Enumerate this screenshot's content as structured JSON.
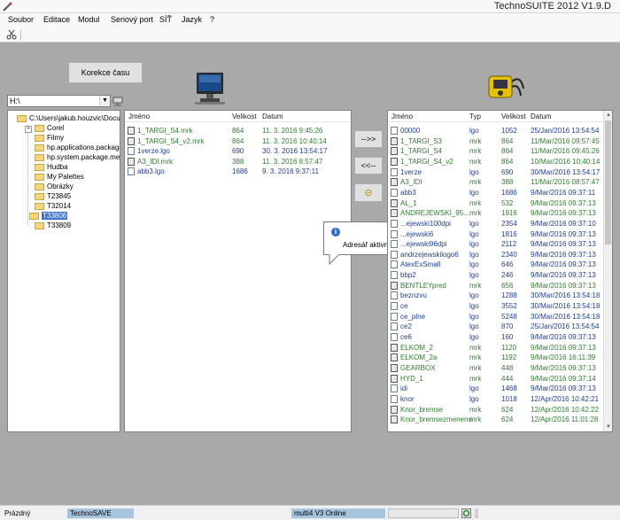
{
  "window": {
    "title": "TechnoSUITE 2012 V1.9.D",
    "app_icon": "pencil-app-icon"
  },
  "menu": [
    "Soubor",
    "Editace",
    "Modul",
    "Seriový port",
    "SÍŤ",
    "Jazyk",
    "?"
  ],
  "toolbar": {
    "tool_icon": "scissors-icon"
  },
  "buttons": {
    "time_correction": "Korekce času",
    "to_device": "-->>",
    "to_pc": "<<--",
    "refresh": "⊝"
  },
  "drive": {
    "value": "H:\\"
  },
  "tree": {
    "items": [
      {
        "label": "C:\\Users\\jakub.houzvic\\Docu"
      },
      {
        "label": "Corel"
      },
      {
        "label": "Filmy"
      },
      {
        "label": "hp.applications.package.a"
      },
      {
        "label": "hp.system.package.metac"
      },
      {
        "label": "Hudba"
      },
      {
        "label": "My Palettes"
      },
      {
        "label": "Obrázky"
      },
      {
        "label": "T23845"
      },
      {
        "label": "T32014"
      },
      {
        "label": "T33806"
      },
      {
        "label": "T33809"
      }
    ],
    "selected": "T33806"
  },
  "pc_list": {
    "headers": {
      "name": "Jméno",
      "size": "Velikost",
      "date": "Datum"
    },
    "rows": [
      {
        "name": "1_TARGI_S4.mrk",
        "size": "864",
        "date": "11. 3. 2016 9:45:26",
        "color": "green",
        "icon": "mrk"
      },
      {
        "name": "1_TARGI_S4_v2.mrk",
        "size": "864",
        "date": "11. 3. 2016 10:40:14",
        "color": "green",
        "icon": "mrk"
      },
      {
        "name": "1verze.lgo",
        "size": "690",
        "date": "30. 3. 2016 13:54:17",
        "color": "blue",
        "icon": "lgo"
      },
      {
        "name": "A3_IDI.mrk",
        "size": "388",
        "date": "11. 3. 2016 8:57:47",
        "color": "green",
        "icon": "mrk"
      },
      {
        "name": "abb3.lgo",
        "size": "1686",
        "date": "9. 3. 2016 9:37:11",
        "color": "blue",
        "icon": "lgo"
      }
    ]
  },
  "tooltip": {
    "text": "Adresář aktivní na PC",
    "icon": "info-icon"
  },
  "device_list": {
    "headers": {
      "name": "Jméno",
      "type": "Typ",
      "size": "Velikost",
      "date": "Datum"
    },
    "rows": [
      {
        "name": "00000",
        "type": "lgo",
        "size": "1052",
        "date": "25/Jan/2016 13:54:54",
        "color": "blue",
        "icon": "lgo"
      },
      {
        "name": "1_TARGI_S3",
        "type": "mrk",
        "size": "864",
        "date": "11/Mar/2016 09:57:45",
        "color": "green",
        "icon": "mrk"
      },
      {
        "name": "1_TARGI_S4",
        "type": "mrk",
        "size": "864",
        "date": "11/Mar/2016 09:45:26",
        "color": "green",
        "icon": "mrk"
      },
      {
        "name": "1_TARGI_S4_v2",
        "type": "mrk",
        "size": "864",
        "date": "10/Mar/2016 10:40:14",
        "color": "green",
        "icon": "mrk"
      },
      {
        "name": "1verze",
        "type": "lgo",
        "size": "690",
        "date": "30/Mar/2016 13:54:17",
        "color": "blue",
        "icon": "lgo"
      },
      {
        "name": "A3_IDI",
        "type": "mrk",
        "size": "388",
        "date": "11/Mar/2016 08:57:47",
        "color": "green",
        "icon": "mrk"
      },
      {
        "name": "abb3",
        "type": "lgo",
        "size": "1686",
        "date": "9/Mar/2016 09:37:11",
        "color": "blue",
        "icon": "lgo"
      },
      {
        "name": "AL_1",
        "type": "mrk",
        "size": "532",
        "date": "9/Mar/2016 09:37:13",
        "color": "green",
        "icon": "mrk"
      },
      {
        "name": "ANDREJEWSKI_95...",
        "type": "mrk",
        "size": "1916",
        "date": "9/Mar/2016 09:37:13",
        "color": "green",
        "icon": "mrk"
      },
      {
        "name": "...ejewski100dpi",
        "type": "lgo",
        "size": "2354",
        "date": "9/Mar/2016 09:37:10",
        "color": "blue",
        "icon": "lgo"
      },
      {
        "name": "...ejewski6",
        "type": "lgo",
        "size": "1816",
        "date": "9/Mar/2016 09:37:13",
        "color": "blue",
        "icon": "lgo"
      },
      {
        "name": "...ejewski96dpi",
        "type": "lgo",
        "size": "2112",
        "date": "9/Mar/2016 09:37:13",
        "color": "blue",
        "icon": "lgo"
      },
      {
        "name": "andrzejewskilogo6",
        "type": "lgo",
        "size": "2340",
        "date": "9/Mar/2016 09:37:13",
        "color": "blue",
        "icon": "lgo"
      },
      {
        "name": "AtexExSmall",
        "type": "lgo",
        "size": "646",
        "date": "9/Mar/2016 09:37:13",
        "color": "blue",
        "icon": "lgo"
      },
      {
        "name": "bbp2",
        "type": "lgo",
        "size": "246",
        "date": "9/Mar/2016 09:37:13",
        "color": "blue",
        "icon": "lgo"
      },
      {
        "name": "BENTLEYpred",
        "type": "mrk",
        "size": "656",
        "date": "9/Mar/2016 09:37:13",
        "color": "green",
        "icon": "mrk"
      },
      {
        "name": "beznzvu",
        "type": "lgo",
        "size": "1288",
        "date": "30/Mar/2016 13:54:18",
        "color": "blue",
        "icon": "lgo"
      },
      {
        "name": "ce",
        "type": "lgo",
        "size": "3552",
        "date": "30/Mar/2016 13:54:18",
        "color": "blue",
        "icon": "lgo"
      },
      {
        "name": "ce_plne",
        "type": "lgo",
        "size": "5248",
        "date": "30/Mar/2016 13:54:18",
        "color": "blue",
        "icon": "lgo"
      },
      {
        "name": "ce2",
        "type": "lgo",
        "size": "870",
        "date": "25/Jan/2016 13:54:54",
        "color": "blue",
        "icon": "lgo"
      },
      {
        "name": "ce6",
        "type": "lgo",
        "size": "160",
        "date": "9/Mar/2016 09:37:13",
        "color": "blue",
        "icon": "lgo"
      },
      {
        "name": "ELKOM_2",
        "type": "mrk",
        "size": "1120",
        "date": "9/Mar/2016 09:37:13",
        "color": "green",
        "icon": "mrk"
      },
      {
        "name": "ELKOM_2a",
        "type": "mrk",
        "size": "1192",
        "date": "9/Mar/2016 16:11:39",
        "color": "green",
        "icon": "mrk"
      },
      {
        "name": "GEARBOX",
        "type": "mrk",
        "size": "448",
        "date": "9/Mar/2016 09:37:13",
        "color": "green",
        "icon": "mrk"
      },
      {
        "name": "HYD_1",
        "type": "mrk",
        "size": "444",
        "date": "9/Mar/2016 09:37:14",
        "color": "green",
        "icon": "mrk"
      },
      {
        "name": "idi",
        "type": "lgo",
        "size": "1468",
        "date": "9/Mar/2016 09:37:13",
        "color": "blue",
        "icon": "lgo"
      },
      {
        "name": "knor",
        "type": "lgo",
        "size": "1018",
        "date": "12/Apr/2016 10:42:21",
        "color": "blue",
        "icon": "lgo"
      },
      {
        "name": "Knor_bremse",
        "type": "mrk",
        "size": "624",
        "date": "12/Apr/2016 10:42:22",
        "color": "green",
        "icon": "mrk"
      },
      {
        "name": "Knor_bremsezmeneno",
        "type": "mrk",
        "size": "624",
        "date": "12/Apr/2016 11:01:28",
        "color": "green",
        "icon": "mrk"
      }
    ]
  },
  "status": {
    "left": "Prázdný",
    "module": "TechnoSAVE",
    "device": "multi4 V3 Online",
    "indicator_icon": "refresh-icon"
  },
  "colors": {
    "mrk_text": "#2e7d2e",
    "lgo_text": "#1f3f99",
    "selection": "#3c74cc",
    "status_panel": "#a7c4df"
  }
}
